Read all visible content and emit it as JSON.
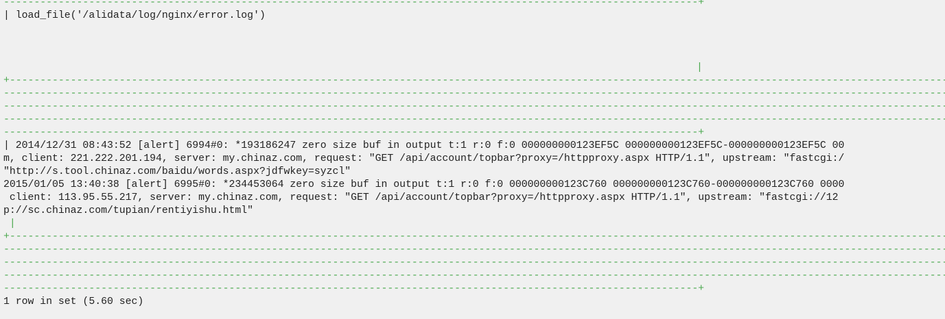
{
  "terminal": {
    "rule_short": "------------------------------------------------------------------------------------------------------------------+",
    "rule_long": "+-----------------------------------------------------------------------------------------------------------------------------------------------------------------------------------------------------",
    "rule_full": "-------------------------------------------------------------------------------------------------------------------------------------------------------------------------------------------------------",
    "header_cell": "| load_file('/alidata/log/nginx/error.log')",
    "pipe_char": "|",
    "pipe_indent": " |",
    "log_lines": [
      "| 2014/12/31 08:43:52 [alert] 6994#0: *193186247 zero size buf in output t:1 r:0 f:0 000000000123EF5C 000000000123EF5C-000000000123EF5C 00",
      "m, client: 221.222.201.194, server: my.chinaz.com, request: \"GET /api/account/topbar?proxy=/httpproxy.aspx HTTP/1.1\", upstream: \"fastcgi:/",
      "\"http://s.tool.chinaz.com/baidu/words.aspx?jdfwkey=syzcl\"",
      "2015/01/05 13:40:38 [alert] 6995#0: *234453064 zero size buf in output t:1 r:0 f:0 000000000123C760 000000000123C760-000000000123C760 0000",
      " client: 113.95.55.217, server: my.chinaz.com, request: \"GET /api/account/topbar?proxy=/httpproxy.aspx HTTP/1.1\", upstream: \"fastcgi://12",
      "p://sc.chinaz.com/tupian/rentiyishu.html\""
    ],
    "result_summary": "1 row in set (5.60 sec)"
  }
}
